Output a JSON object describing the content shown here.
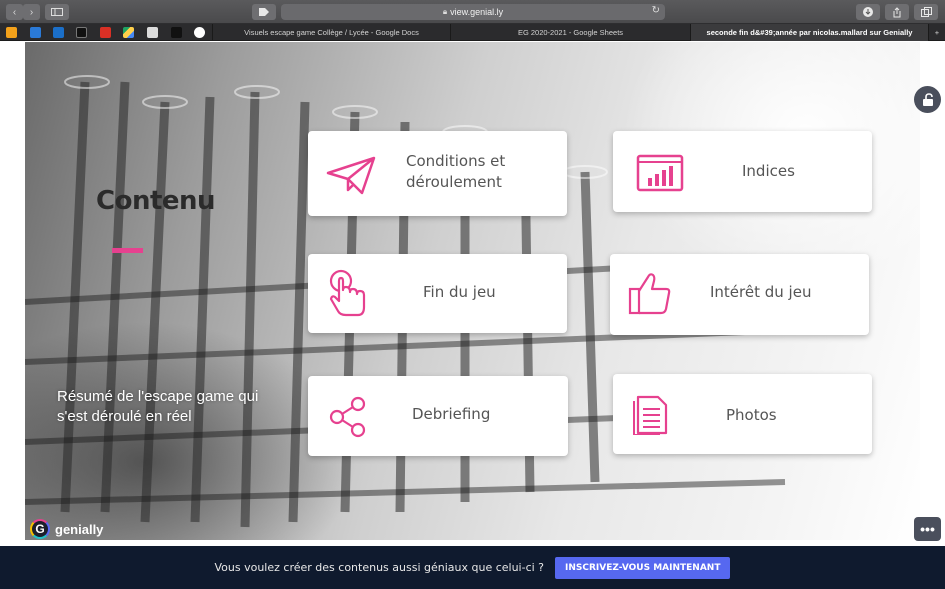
{
  "browser": {
    "url": "view.genial.ly",
    "tabs": [
      {
        "title": "Visuels escape game Collège / Lycée - Google Docs",
        "active": false
      },
      {
        "title": "EG 2020-2021 - Google Sheets",
        "active": false
      },
      {
        "title": "seconde fin d&#39;année par nicolas.mallard sur Genially",
        "active": true
      }
    ],
    "new_tab_label": "+"
  },
  "slide": {
    "title": "Contenu",
    "summary": "Résumé de l'escape game qui s'est déroulé en réel",
    "accent_color": "#e6418f",
    "cards": [
      {
        "label": "Conditions et déroulement",
        "icon": "paper-plane-icon"
      },
      {
        "label": "Indices",
        "icon": "bar-chart-board-icon"
      },
      {
        "label": "Fin du jeu",
        "icon": "tap-hand-icon"
      },
      {
        "label": "Intérêt du jeu",
        "icon": "thumbs-up-icon"
      },
      {
        "label": "Debriefing",
        "icon": "share-icon"
      },
      {
        "label": "Photos",
        "icon": "document-icon"
      }
    ]
  },
  "brand": {
    "name": "genially",
    "logo_letter": "G"
  },
  "more_label": "•••",
  "banner": {
    "message": "Vous voulez créer des contenus aussi géniaux que celui-ci ?",
    "cta": "INSCRIVEZ-VOUS MAINTENANT"
  }
}
